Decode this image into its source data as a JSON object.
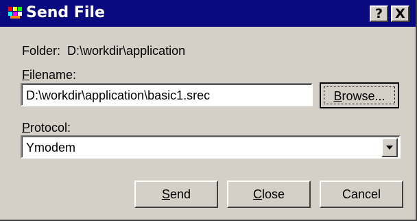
{
  "window": {
    "title": "Send File",
    "help_button": "?",
    "close_button": "X"
  },
  "folder": {
    "label": "Folder:",
    "path": "D:\\workdir\\application"
  },
  "filename": {
    "label_mnemonic": "F",
    "label_rest": "ilename:",
    "value": "D:\\workdir\\application\\basic1.srec",
    "browse_mnemonic": "B",
    "browse_rest": "rowse..."
  },
  "protocol": {
    "label_mnemonic": "P",
    "label_rest": "rotocol:",
    "value": "Ymodem"
  },
  "buttons": {
    "send_mnemonic": "S",
    "send_rest": "end",
    "close_mnemonic": "C",
    "close_rest": "lose",
    "cancel": "Cancel"
  },
  "icons": {
    "app": "terminal-app-icon",
    "dropdown": "chevron-down-icon"
  },
  "colors": {
    "titlebar": "#0a0a80",
    "face": "#d4d0c8"
  }
}
